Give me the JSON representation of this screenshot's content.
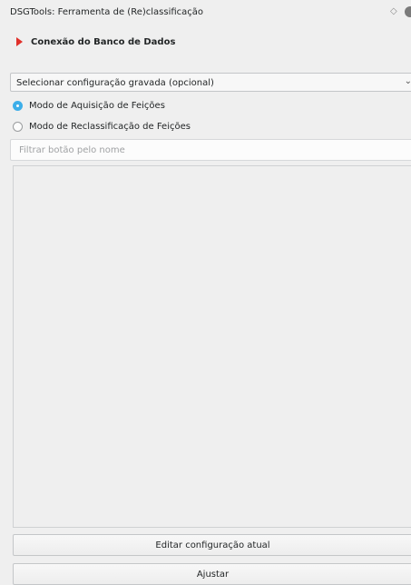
{
  "window": {
    "title": "DSGTools: Ferramenta de (Re)classificação",
    "float_icon": "◇"
  },
  "section": {
    "label": "Conexão do Banco de Dados"
  },
  "config_select": {
    "value": "Selecionar configuração gravada (opcional)",
    "arrow": "⌄"
  },
  "modes": [
    {
      "label": "Modo de Aquisição de Feições",
      "checked": true
    },
    {
      "label": "Modo de Reclassificação de Feições",
      "checked": false
    }
  ],
  "filter": {
    "placeholder": "Filtrar botão pelo nome"
  },
  "buttons": {
    "edit_label": "Editar configuração atual",
    "adjust_label": "Ajustar"
  },
  "colors": {
    "accent": "#3daee9",
    "section_marker": "#e0302a"
  }
}
